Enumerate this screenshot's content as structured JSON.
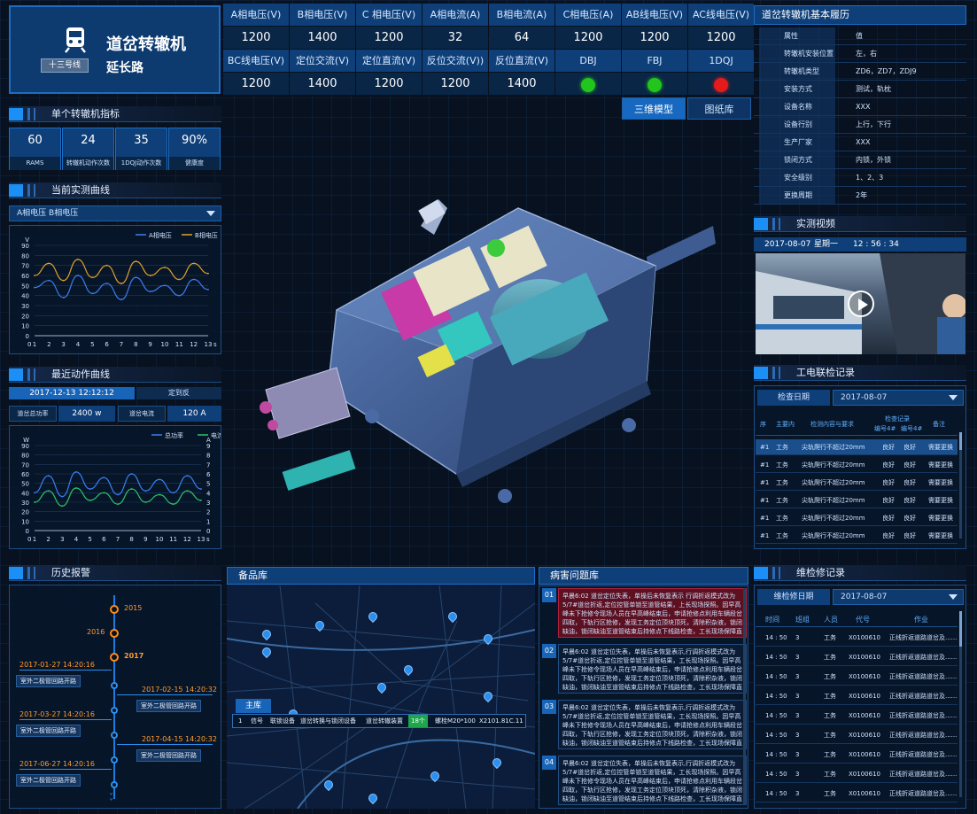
{
  "header": {
    "title": "道岔转辙机",
    "subtitle": "延长路",
    "line_badge": "十三号线"
  },
  "readings": {
    "headers1": [
      "A相电压(V)",
      "B相电压(V)",
      "C 相电压(V)",
      "A相电流(A)",
      "B相电流(A)",
      "C相电压(A)",
      "AB线电压(V)",
      "AC线电压(V)"
    ],
    "values1": [
      "1200",
      "1400",
      "1200",
      "32",
      "64",
      "1200",
      "1200",
      "1200"
    ],
    "headers2": [
      "BC线电压(V)",
      "定位交流(V)",
      "定位直流(V)",
      "反位交流(V))",
      "反位直流(V)",
      "DBJ",
      "FBJ",
      "1DQJ"
    ],
    "values2": [
      "1200",
      "1400",
      "1200",
      "1200",
      "1400"
    ],
    "lamps": [
      {
        "name": "DBJ",
        "color": "#21c51b"
      },
      {
        "name": "FBJ",
        "color": "#21c51b"
      },
      {
        "name": "1DQJ",
        "color": "#e31b1b"
      }
    ]
  },
  "view_tabs": [
    "三维模型",
    "图纸库"
  ],
  "single_indicators": {
    "title": "单个转辙机指标",
    "items": [
      {
        "value": "60",
        "label": "RAMS"
      },
      {
        "value": "24",
        "label": "转辙机动作次数"
      },
      {
        "value": "35",
        "label": "1DQJ动作次数"
      },
      {
        "value": "90%",
        "label": "健康度"
      }
    ]
  },
  "current_curve": {
    "title": "当前实测曲线",
    "select": "A相电压  B相电压",
    "chart_data": {
      "type": "line",
      "ylabel": "V",
      "xlabel": "s",
      "ylim": [
        0,
        90
      ],
      "yticks": [
        "0",
        "10",
        "20",
        "30",
        "40",
        "50",
        "60",
        "70",
        "80",
        "90"
      ],
      "x": [
        1,
        2,
        3,
        4,
        5,
        6,
        7,
        8,
        9,
        10,
        11,
        12,
        13
      ],
      "series": [
        {
          "name": "A相电压",
          "color": "#3b7ff0",
          "values": [
            48,
            55,
            38,
            60,
            42,
            52,
            36,
            58,
            44,
            50,
            40,
            56,
            46
          ]
        },
        {
          "name": "B相电压",
          "color": "#e0a12a",
          "values": [
            60,
            72,
            55,
            76,
            58,
            70,
            52,
            74,
            60,
            68,
            56,
            72,
            62
          ]
        }
      ]
    }
  },
  "recent_action": {
    "title": "最近动作曲线",
    "time": "2017-12-13 12:12:12",
    "mode": "定到反",
    "power_label": "道岔总功率",
    "power_value": "2400 w",
    "current_label": "道岔电流",
    "current_value": "120 A",
    "chart_data": {
      "type": "line",
      "ylabel": "W",
      "y2label": "A",
      "xlabel": "s",
      "ylim": [
        0,
        90
      ],
      "yticks": [
        "0",
        "10",
        "20",
        "30",
        "40",
        "50",
        "60",
        "70",
        "80",
        "90"
      ],
      "y2ticks": [
        "0",
        "1",
        "2",
        "3",
        "4",
        "5",
        "6",
        "7",
        "8",
        "9"
      ],
      "x": [
        1,
        2,
        3,
        4,
        5,
        6,
        7,
        8,
        9,
        10,
        11,
        12,
        13
      ],
      "series": [
        {
          "name": "总功率",
          "color": "#3b7ff0",
          "values": [
            40,
            58,
            36,
            62,
            44,
            56,
            38,
            60,
            42,
            54,
            40,
            58,
            44
          ]
        },
        {
          "name": "电流",
          "color": "#2fc36a",
          "values": [
            30,
            42,
            26,
            45,
            32,
            40,
            28,
            44,
            30,
            38,
            28,
            42,
            32
          ]
        }
      ]
    }
  },
  "history_alarm": {
    "title": "历史报警",
    "years": [
      "2015",
      "2016",
      "2017"
    ],
    "events": [
      {
        "time": "2017-01-27 14:20:16",
        "text": "室外二极管回路开路"
      },
      {
        "time": "2017-02-15 14:20:32",
        "text": "室外二极管回路开路"
      },
      {
        "time": "2017-03-27 14:20:16",
        "text": "室外二极管回路开路"
      },
      {
        "time": "2017-04-15 14:20:32",
        "text": "室外二极管回路开路"
      },
      {
        "time": "2017-06-27 14:20:16",
        "text": "室外二极管回路开路"
      }
    ]
  },
  "spare_parts": {
    "title": "备品库",
    "popup_tab": "主库",
    "popup_row": {
      "idx": "1",
      "type": "信号",
      "c1": "联锁设备",
      "c2": "道岔转换与锁闭设备",
      "c3": "道岔转辙装置",
      "count": "18个",
      "spec": "螺栓M20*100",
      "code": "X2101.81C.11"
    }
  },
  "issues": {
    "title": "病害问题库",
    "items": [
      {
        "num": "01",
        "text": "早晨6:02 道岔定位失表，单操后未恢复表示 行调折返模式改为5/7#道岔折返,定位控管单锁至道管结果，上长现场探照。因早高峰未下抢修令现场人员在早高峰结束后，申请抢修点利用车辆段岔四取，下轨行区抢修，发现工务定位顶块顶死，清除积杂液，锁闭缺油，锁闭缺油至道管结束后持修点下线路检查，工长现场保障直到运营结束。"
      },
      {
        "num": "02",
        "text": "早晨6:02 道岔定位失表，单操后未恢复表示,行调折返模式改为5/7#道岔折返,定位控管单锁至道管结果，工长现场探照。因早高峰未下抢修令现场人员在早高峰结束后，申请抢修点利用车辆段岔四取，下轨行区抢修，发现工务定位顶块顶死，清除积杂液，锁闭缺油，锁闭缺油至道管结束后持修点下线路检查，工长现场保障直到运营结束。"
      },
      {
        "num": "03",
        "text": "早晨6:02 道岔定位失表，单操后未恢复表示,行调折返模式改为5/7#道岔折返,定位控管单锁至道管结果，工长现场探照。因早高峰未下抢修令现场人员在早高峰结束后，申请抢修点利用车辆段岔四取，下轨行区抢修，发现工务定位顶块顶死，清除积杂液，锁闭缺油，锁闭缺油至道管结束后持修点下线路检查，工长现场保障直到运营结束。"
      },
      {
        "num": "04",
        "text": "早晨6:02 道岔定位失表，单操后未恢复表示,行调折返模式改为5/7#道岔折返,定位控管单锁至道管结果，工长现场探照。因早高峰未下抢修令现场人员在早高峰结束后，申请抢修点利用车辆段岔四取，下轨行区抢修，发现工务定位顶块顶死，清除积杂液，锁闭缺油，锁闭缺油至道管结束后持修点下线路检查，工长现场保障直到运营结束。"
      }
    ]
  },
  "basic_history": {
    "title": "道岔转辙机基本履历",
    "rows": [
      {
        "k": "属性",
        "v": "值"
      },
      {
        "k": "转辙机安装位置",
        "v": "左，右"
      },
      {
        "k": "转辙机类型",
        "v": "ZD6，ZD7，ZDJ9"
      },
      {
        "k": "安装方式",
        "v": "测试，轨枕"
      },
      {
        "k": "设备名称",
        "v": "XXX"
      },
      {
        "k": "设备行别",
        "v": "上行，下行"
      },
      {
        "k": "生产厂家",
        "v": "XXX"
      },
      {
        "k": "锁闭方式",
        "v": "内锁，外锁"
      },
      {
        "k": "安全级别",
        "v": "1、2、3"
      },
      {
        "k": "更换周期",
        "v": "2年"
      }
    ]
  },
  "live_video": {
    "title": "实测视频",
    "date": "2017-08-07",
    "weekday": "星期一",
    "time": "12 : 56 : 34"
  },
  "joint_inspection": {
    "title": "工电联检记录",
    "date_label": "检查日期",
    "date_value": "2017-08-07",
    "columns": [
      "序",
      "主要内",
      "检测内容与要求",
      "检查记录",
      "备注"
    ],
    "sub_columns": [
      "编号4#",
      "编号4#"
    ],
    "rows": [
      [
        "#1",
        "工务",
        "尖轨爬行不超过20mm",
        "良好",
        "良好",
        "需要更换"
      ],
      [
        "#1",
        "工务",
        "尖轨爬行不超过20mm",
        "良好",
        "良好",
        "需要更换"
      ],
      [
        "#1",
        "工务",
        "尖轨爬行不超过20mm",
        "良好",
        "良好",
        "需要更换"
      ],
      [
        "#1",
        "工务",
        "尖轨爬行不超过20mm",
        "良好",
        "良好",
        "需要更换"
      ],
      [
        "#1",
        "工务",
        "尖轨爬行不超过20mm",
        "良好",
        "良好",
        "需要更换"
      ],
      [
        "#1",
        "工务",
        "尖轨爬行不超过20mm",
        "良好",
        "良好",
        "需要更换"
      ]
    ]
  },
  "maintenance": {
    "title": "维检修记录",
    "date_label": "维检修日期",
    "date_value": "2017-08-07",
    "columns": [
      "时间",
      "班组",
      "人员",
      "代号",
      "作业"
    ],
    "rows": [
      [
        "14 : 50",
        "3",
        "工务",
        "X0100610",
        "正线折返道路道岔及......"
      ],
      [
        "14 : 50",
        "3",
        "工务",
        "X0100610",
        "正线折返道路道岔及......"
      ],
      [
        "14 : 50",
        "3",
        "工务",
        "X0100610",
        "正线折返道路道岔及......"
      ],
      [
        "14 : 50",
        "3",
        "工务",
        "X0100610",
        "正线折返道路道岔及......"
      ],
      [
        "14 : 50",
        "3",
        "工务",
        "X0100610",
        "正线折返道路道岔及......"
      ],
      [
        "14 : 50",
        "3",
        "工务",
        "X0100610",
        "正线折返道路道岔及......"
      ],
      [
        "14 : 50",
        "3",
        "工务",
        "X0100610",
        "正线折返道路道岔及......"
      ],
      [
        "14 : 50",
        "3",
        "工务",
        "X0100610",
        "正线折返道路道岔及......"
      ],
      [
        "14 : 50",
        "3",
        "工务",
        "X0100610",
        "正线折返道路道岔及......"
      ]
    ]
  }
}
